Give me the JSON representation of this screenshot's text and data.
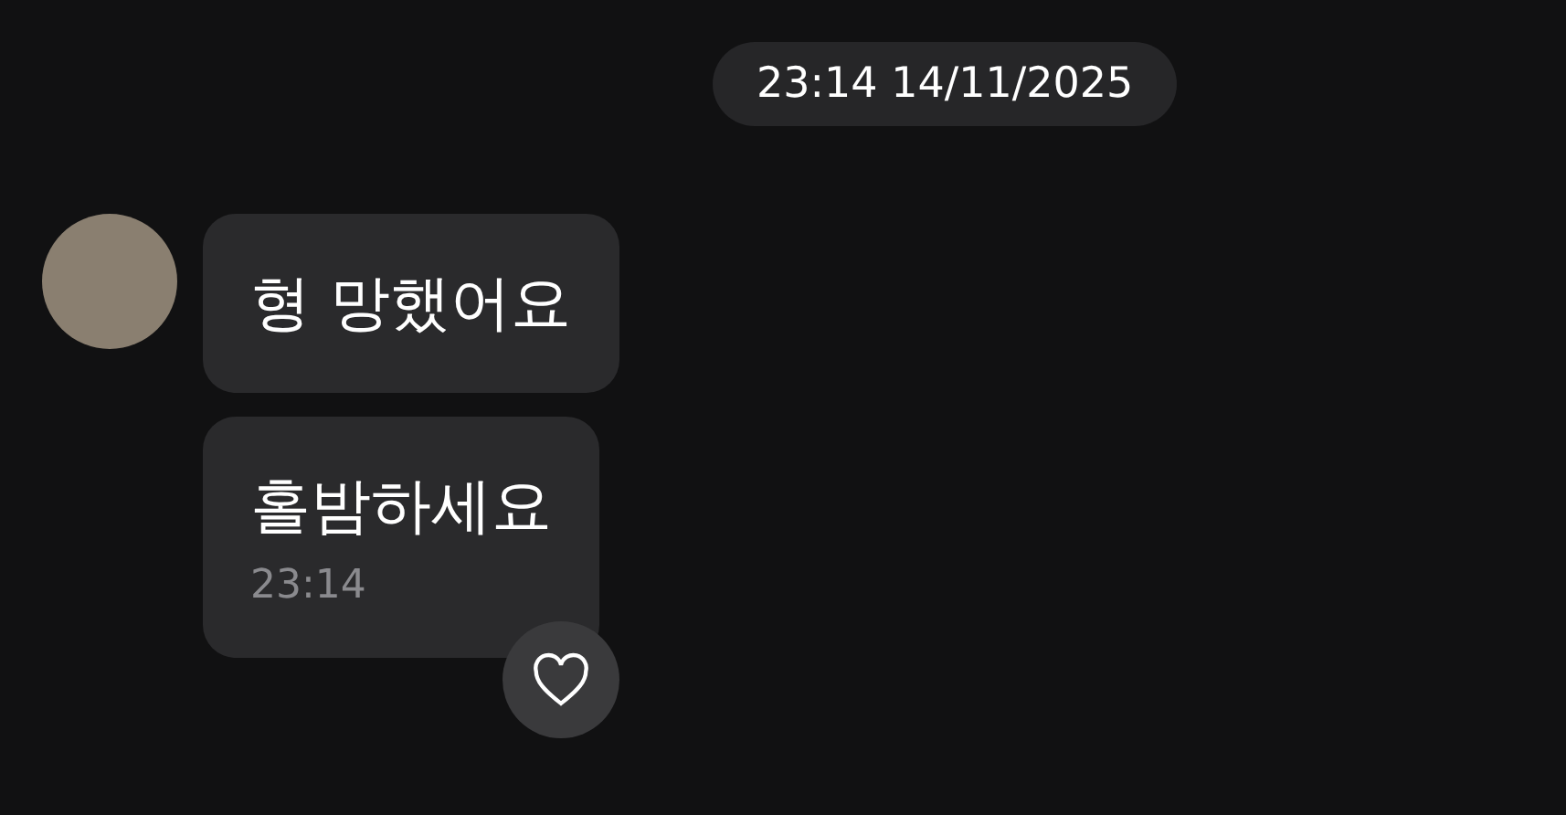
{
  "date_header": "23:14 14/11/2025",
  "messages": [
    {
      "text": "형 망했어요"
    },
    {
      "text": "홀밤하세요",
      "time": "23:14"
    }
  ],
  "reaction": {
    "liked": false
  }
}
